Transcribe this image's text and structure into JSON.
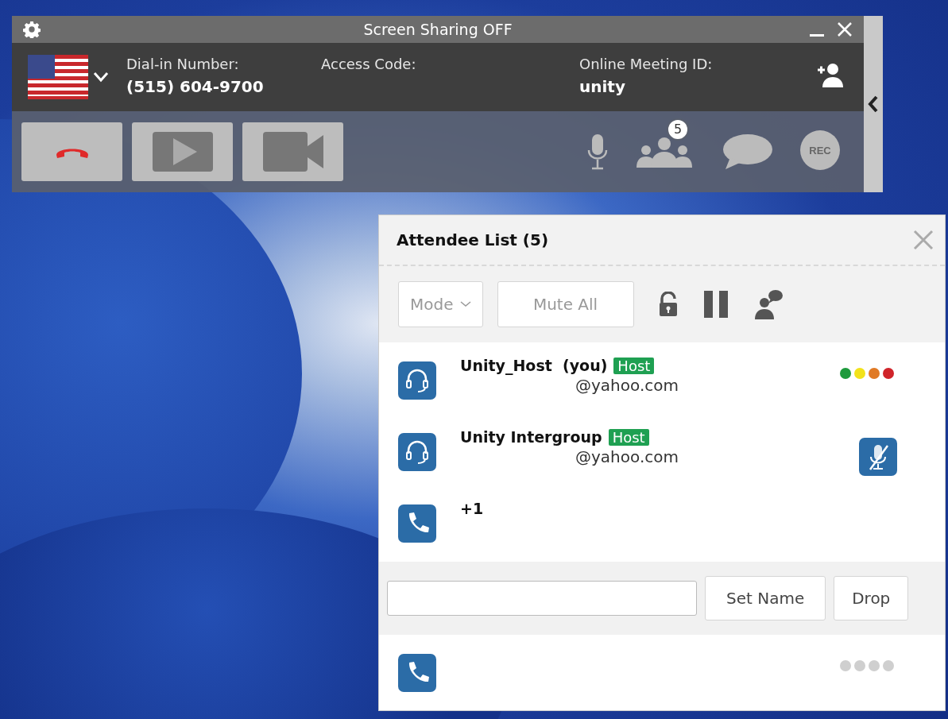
{
  "toolbar": {
    "title": "Screen Sharing OFF",
    "info": [
      {
        "label": "Dial-in Number:",
        "value": "(515) 604-9700"
      },
      {
        "label": "Access Code:"
      },
      {
        "label": "Online Meeting ID:",
        "value": "unity"
      }
    ],
    "participants_count": "5",
    "record_label": "REC"
  },
  "attendee_panel": {
    "title": "Attendee List (5)",
    "mode_label": "Mode",
    "mute_all_label": "Mute All",
    "attendees": [
      {
        "kind": "headset",
        "name": "Unity_Host  (you)",
        "badge": "Host",
        "email": "@yahoo.com",
        "muted": false,
        "editing": false,
        "dots": [
          {
            "color": "#1e9a3c"
          },
          {
            "color": "#f2e21a"
          },
          {
            "color": "#e07a25"
          },
          {
            "color": "#d0242a"
          }
        ]
      },
      {
        "kind": "headset",
        "name": "Unity Intergroup",
        "badge": "Host",
        "email": "@yahoo.com",
        "muted": true,
        "editing": false
      },
      {
        "kind": "phone",
        "name": "+1",
        "muted": false,
        "editing": true
      },
      {
        "kind": "phone",
        "muted": false,
        "editing": false,
        "dots": [
          {
            "color": "#cfcfcf"
          },
          {
            "color": "#cfcfcf"
          },
          {
            "color": "#cfcfcf"
          },
          {
            "color": "#cfcfcf"
          }
        ]
      }
    ],
    "name_editor": {
      "set_label": "Set Name",
      "drop_label": "Drop"
    }
  }
}
